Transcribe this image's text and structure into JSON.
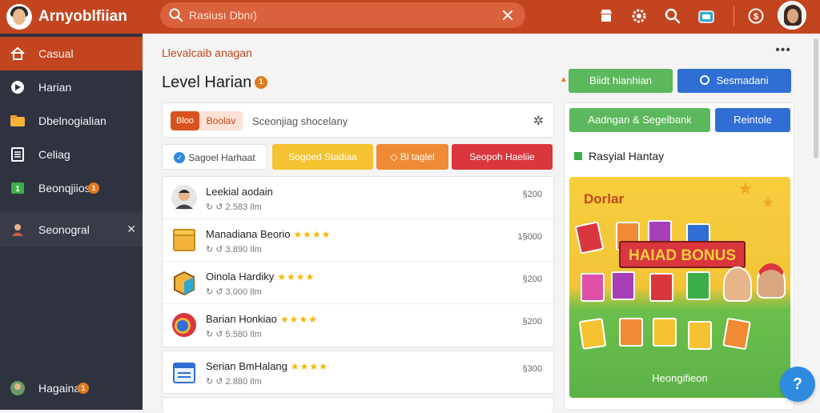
{
  "app": {
    "title": "Arnyoblfiian"
  },
  "search": {
    "text": "Rasiusı Dbnı)"
  },
  "topbar": {
    "icons": [
      "shop-icon",
      "gear-icon",
      "search-icon",
      "gift-icon",
      "coin-icon",
      "user-avatar"
    ]
  },
  "sidebar": {
    "items": [
      {
        "label": "Casual",
        "icon": "home-icon",
        "active": true
      },
      {
        "label": "Harian",
        "icon": "compass-icon"
      },
      {
        "label": "Dbelnogialian",
        "icon": "folder-icon"
      },
      {
        "label": "Celiag",
        "icon": "list-icon"
      },
      {
        "label": "Beonqjiios",
        "icon": "badge-icon",
        "badge": "1"
      },
      {
        "label": "Seonogral",
        "icon": "avatar-icon"
      }
    ],
    "footer": {
      "label": "Hagainan",
      "badge": "1"
    }
  },
  "main": {
    "breadcrumb": "Llevalcaib anagan",
    "title": "Level Harian",
    "title_badge": "1",
    "btn_top_green": "Biidt hianhian",
    "btn_top_blue": "Sesmadani",
    "btn_green2": "Aadngan   &  Segelbank",
    "btn_blue2": "Reintole",
    "filter": {
      "chip": "Bloo",
      "chip_soft": "Boolav",
      "text": "Sceonjiag shocelany"
    },
    "tags": {
      "white": "Sagoel Harhaat",
      "yellow": "Sogoed Stadiaa",
      "orange": "Bi taglel",
      "red": "Seopoh Haeliie"
    },
    "rows": [
      {
        "title": "Leekial aodain",
        "stars": "",
        "sub": "↻ ↺ 2.583 Ilm",
        "value": "§200"
      },
      {
        "title": "Manadiana Beorio",
        "stars": "★★★★",
        "sub": "↻ ↺ 3.890 Ilm",
        "value": "1§000"
      },
      {
        "title": "Oinola Hardiky",
        "stars": "★★★★",
        "sub": "↻ ↺ 3.000 Ilm",
        "value": "§200"
      },
      {
        "title": "Barian Honkiao",
        "stars": "★★★★",
        "sub": "↻ ↺ 5.580 Ilm",
        "value": "§200"
      },
      {
        "title": "Serian BmHalang",
        "stars": "★★★★",
        "sub": "↻ ↺ 2.880 Ilm",
        "value": "§300"
      }
    ],
    "panel": {
      "heading": "Rasyial Hantay",
      "promo_label": "Dorlar",
      "promo_banner": "HAIAD BONUS",
      "promo_footer": "Heongifieon"
    }
  },
  "help": {
    "label": "?"
  },
  "colors": {
    "accent": "#c2451f",
    "sidebar": "#2f3340",
    "green": "#5cb85c",
    "blue": "#2f6fd4"
  }
}
